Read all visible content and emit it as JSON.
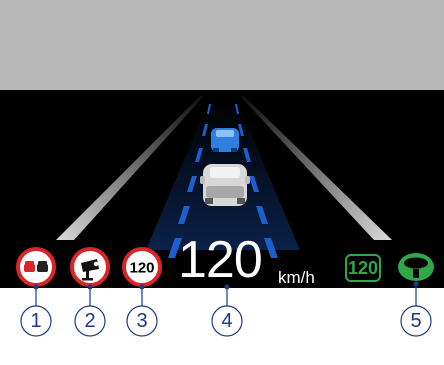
{
  "colors": {
    "background_top": "#b8b8b8",
    "display_background": "#000000",
    "lane_marker_blue": "#1e5fd0",
    "car_ahead": "#2f7fe0",
    "own_car": "#d8d8d8",
    "sign_red": "#d9252a",
    "active_green": "#2fa84a",
    "callout_blue": "#1a3a8a"
  },
  "indicators": {
    "no_overtaking": {
      "icon": "no-overtaking-icon"
    },
    "speed_camera": {
      "icon": "speed-camera-icon"
    },
    "speed_limit": {
      "value": "120",
      "icon": "speed-limit-sign-icon"
    },
    "current_speed": {
      "value": "120",
      "unit": "km/h"
    },
    "set_speed": {
      "value": "120"
    },
    "steering_assist": {
      "icon": "steering-wheel-icon"
    }
  },
  "callouts": [
    "1",
    "2",
    "3",
    "4",
    "5"
  ]
}
